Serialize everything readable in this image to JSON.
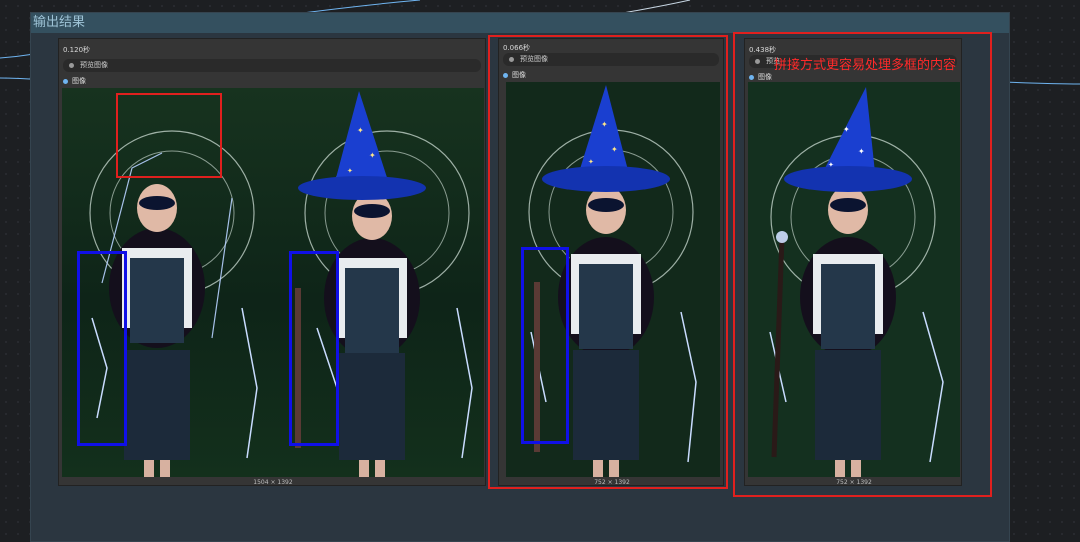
{
  "group": {
    "title": "输出结果"
  },
  "nodes": [
    {
      "time": "0.120秒",
      "preview_label": "预览图像",
      "output_label": "图像",
      "dims": "1504 × 1392"
    },
    {
      "time": "0.066秒",
      "preview_label": "预览图像",
      "output_label": "图像",
      "dims": "752 × 1392"
    },
    {
      "time": "0.438秒",
      "preview_label": "预览",
      "output_label": "图像",
      "dims": "752 × 1392"
    }
  ],
  "annotation": {
    "text": "拼接方式更容易处理多框的内容"
  },
  "colors": {
    "red_annotation": "#e0201e",
    "blue_box": "#1010e8",
    "hat_blue": "#1a3fd0",
    "lightning": "#8fb8ff",
    "link": "#6fb4f0"
  },
  "icons": [
    "widget-dot-icon",
    "output-port-icon"
  ]
}
